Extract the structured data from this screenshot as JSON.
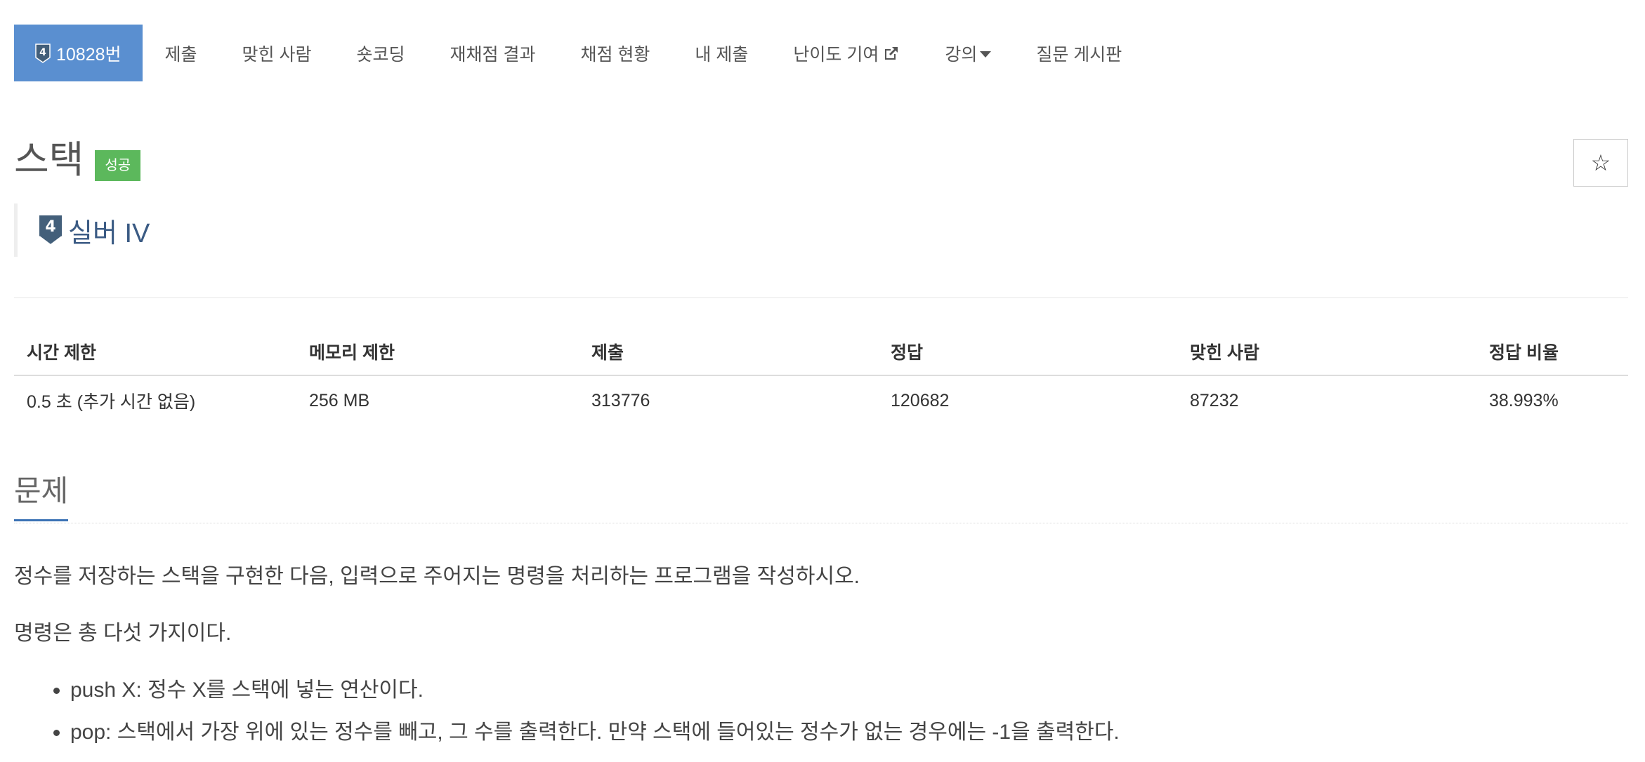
{
  "nav": {
    "items": [
      {
        "label": "10828번",
        "tier_number": "4",
        "active": true
      },
      {
        "label": "제출"
      },
      {
        "label": "맞힌 사람"
      },
      {
        "label": "숏코딩"
      },
      {
        "label": "재채점 결과"
      },
      {
        "label": "채점 현황"
      },
      {
        "label": "내 제출"
      },
      {
        "label": "난이도 기여",
        "icon": "external-link-icon"
      },
      {
        "label": "강의",
        "icon": "caret-down-icon"
      },
      {
        "label": "질문 게시판"
      }
    ]
  },
  "problem": {
    "title": "스택",
    "status": "성공",
    "tier_number": "4",
    "tier_label": "실버 IV",
    "star_icon": "☆"
  },
  "colors": {
    "active_tab": "#5a8fd0",
    "success": "#5cb85c",
    "tier_text": "#3b5b84",
    "tier_badge": "#435f7a",
    "section_underline": "#3b72b5"
  },
  "stats": {
    "headers": [
      "시간 제한",
      "메모리 제한",
      "제출",
      "정답",
      "맞힌 사람",
      "정답 비율"
    ],
    "values": [
      "0.5 초 (추가 시간 없음)",
      "256 MB",
      "313776",
      "120682",
      "87232",
      "38.993%"
    ]
  },
  "section": {
    "title": "문제",
    "paragraphs": [
      "정수를 저장하는 스택을 구현한 다음, 입력으로 주어지는 명령을 처리하는 프로그램을 작성하시오.",
      "명령은 총 다섯 가지이다."
    ],
    "commands": [
      "push X: 정수 X를 스택에 넣는 연산이다.",
      "pop: 스택에서 가장 위에 있는 정수를 빼고, 그 수를 출력한다. 만약 스택에 들어있는 정수가 없는 경우에는 -1을 출력한다."
    ]
  }
}
